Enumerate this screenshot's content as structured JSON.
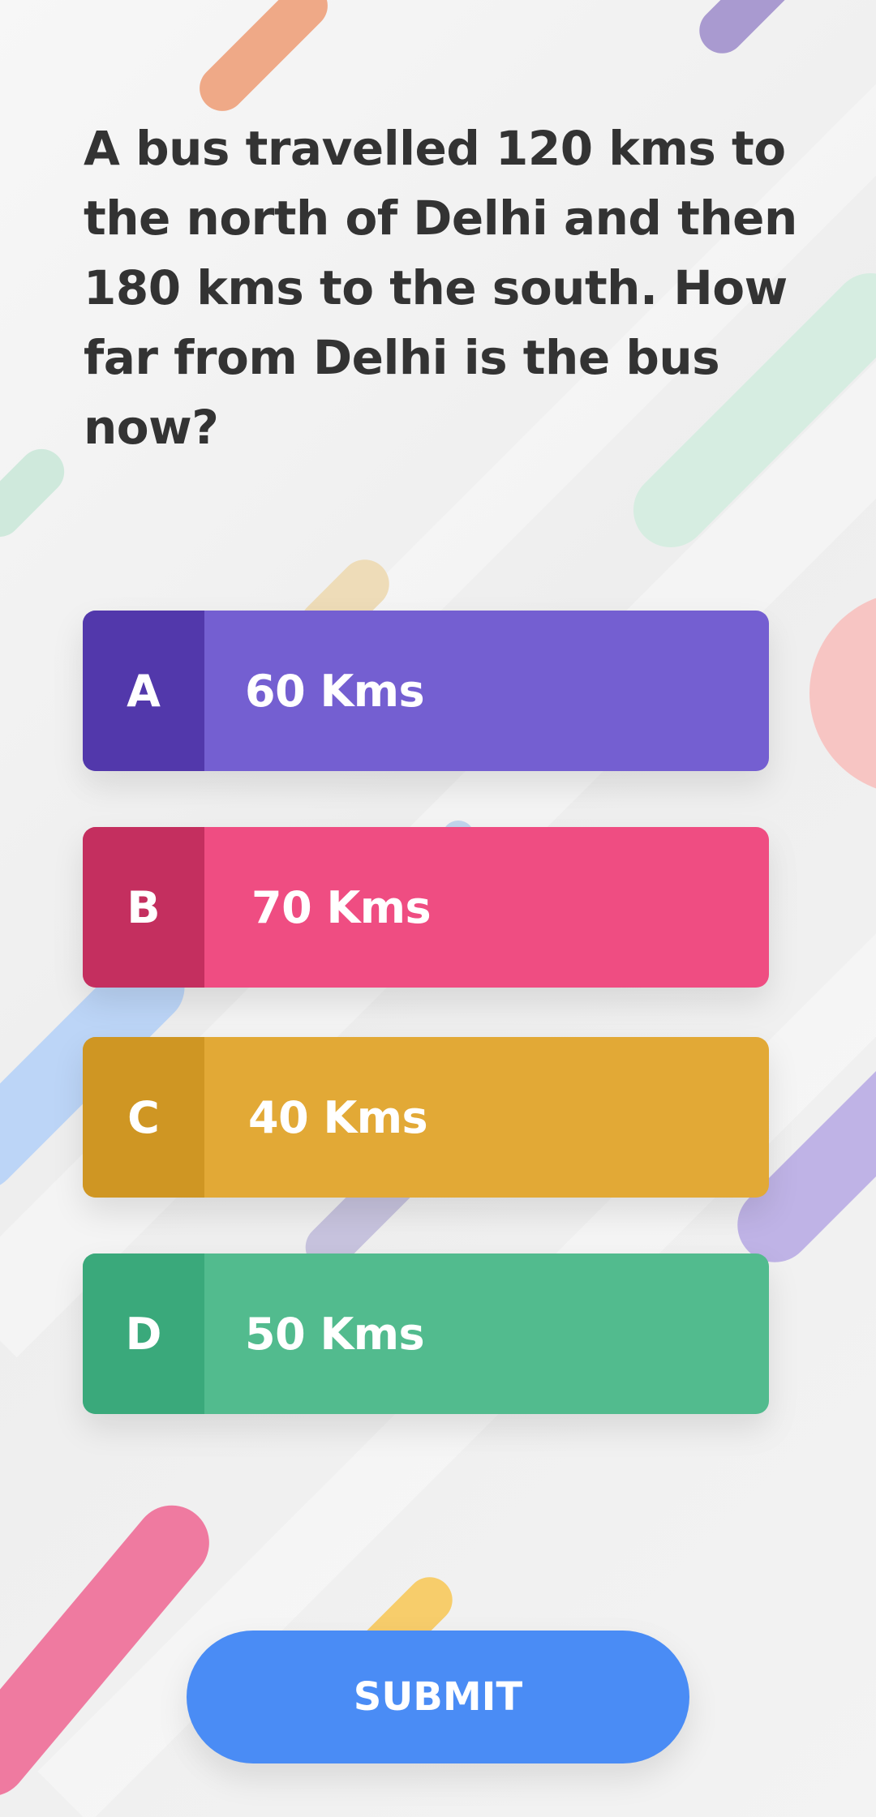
{
  "question": {
    "text": "A bus travelled 120 kms to the north of Delhi and then 180 kms to the south. How far from Delhi is the bus now?"
  },
  "options": [
    {
      "letter": "A",
      "label": "60 Kms",
      "color": "#745fd1",
      "letter_color": "#5238ab"
    },
    {
      "letter": "B",
      "label": "70 Kms",
      "color": "#ef4d82",
      "letter_color": "#c42f5f"
    },
    {
      "letter": "C",
      "label": "40 Kms",
      "color": "#e2a936",
      "letter_color": "#cf9623"
    },
    {
      "letter": "D",
      "label": "50 Kms",
      "color": "#52bb8e",
      "letter_color": "#3aa97b"
    }
  ],
  "submit": {
    "label": "SUBMIT",
    "color": "#4a8cf5"
  }
}
